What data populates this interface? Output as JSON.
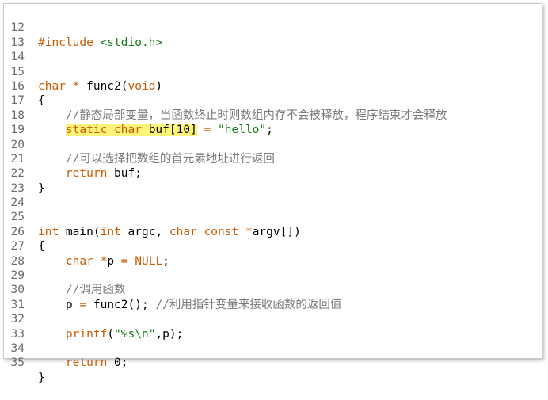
{
  "editor": {
    "lines": [
      {
        "num": "12",
        "code": "#include <stdio.h>"
      },
      {
        "num": "13",
        "code": ""
      },
      {
        "num": "14",
        "code": ""
      },
      {
        "num": "15",
        "code": "char * func2(void)"
      },
      {
        "num": "16",
        "code": "{"
      },
      {
        "num": "17",
        "code": "    //静态局部变量，当函数终止时则数组内存不会被释放，程序结束才会释放"
      },
      {
        "num": "18",
        "code": "    static char buf[10] = \"hello\";"
      },
      {
        "num": "19",
        "code": ""
      },
      {
        "num": "20",
        "code": "    //可以选择把数组的首元素地址进行返回"
      },
      {
        "num": "21",
        "code": "    return buf;"
      },
      {
        "num": "22",
        "code": "}"
      },
      {
        "num": "23",
        "code": ""
      },
      {
        "num": "24",
        "code": ""
      },
      {
        "num": "25",
        "code": "int main(int argc, char const *argv[])"
      },
      {
        "num": "26",
        "code": "{"
      },
      {
        "num": "27",
        "code": "    char *p = NULL;"
      },
      {
        "num": "28",
        "code": ""
      },
      {
        "num": "29",
        "code": "    //调用函数"
      },
      {
        "num": "30",
        "code": "    p = func2(); //利用指针变量来接收函数的返回值"
      },
      {
        "num": "31",
        "code": ""
      },
      {
        "num": "32",
        "code": "    printf(\"%s\\n\",p);"
      },
      {
        "num": "33",
        "code": ""
      },
      {
        "num": "34",
        "code": "    return 0;"
      },
      {
        "num": "35",
        "code": "}"
      }
    ],
    "highlighted_line": "18",
    "colors": {
      "keyword": "#cc5a00",
      "comment": "#7a7a7a",
      "string": "#1a7a1a",
      "highlight": "#fff47a"
    }
  }
}
